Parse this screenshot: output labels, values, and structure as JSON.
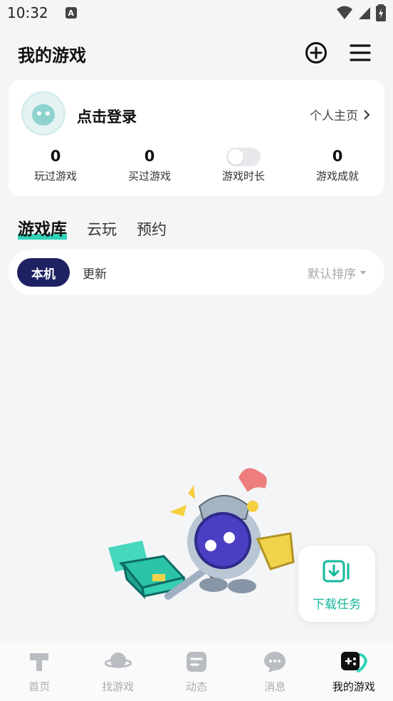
{
  "status_bar": {
    "time": "10:32",
    "notification_letter": "A"
  },
  "header": {
    "title": "我的游戏",
    "add_icon": "plus-circle-icon",
    "menu_icon": "hamburger-menu-icon"
  },
  "profile": {
    "login_text": "点击登录",
    "homepage_link": "个人主页",
    "stats": [
      {
        "value": "0",
        "label": "玩过游戏"
      },
      {
        "value": "0",
        "label": "买过游戏"
      },
      {
        "value": "",
        "label": "游戏时长",
        "toggle": false
      },
      {
        "value": "0",
        "label": "游戏成就"
      }
    ]
  },
  "tabs": [
    {
      "label": "游戏库",
      "active": true
    },
    {
      "label": "云玩",
      "active": false
    },
    {
      "label": "预约",
      "active": false
    }
  ],
  "filters": {
    "local_label": "本机",
    "update_label": "更新",
    "sort_label": "默认排序"
  },
  "download_task": {
    "label": "下载任务"
  },
  "bottom_nav": [
    {
      "label": "首页",
      "icon": "home-hammer-icon",
      "active": false
    },
    {
      "label": "找游戏",
      "icon": "planet-icon",
      "active": false
    },
    {
      "label": "动态",
      "icon": "feed-icon",
      "active": false
    },
    {
      "label": "消息",
      "icon": "chat-bubble-icon",
      "active": false
    },
    {
      "label": "我的游戏",
      "icon": "gamepad-icon",
      "active": true
    }
  ],
  "colors": {
    "accent_teal": "#2fd3b8",
    "active_pill": "#1e2263",
    "download_text": "#15b89b",
    "background": "#f4f5f7"
  }
}
